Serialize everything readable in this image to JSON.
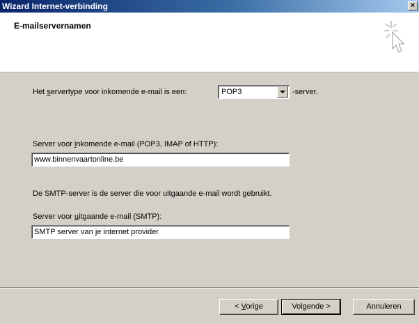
{
  "window": {
    "title": "Wizard Internet-verbinding",
    "close_glyph": "×"
  },
  "header": {
    "title": "E-mailservernamen"
  },
  "incoming_type": {
    "label_pre": "Het ",
    "label_accel": "s",
    "label_post": "ervertype voor inkomende e-mail is een:",
    "selected": "POP3",
    "suffix": "-server."
  },
  "incoming_server": {
    "label_pre": "Server voor ",
    "label_accel": "i",
    "label_post": "nkomende e-mail (POP3, IMAP of HTTP):",
    "value": "www.binnenvaartonline.be"
  },
  "smtp_info": {
    "text": "De SMTP-server is de server die voor uitgaande e-mail wordt gebruikt."
  },
  "outgoing_server": {
    "label_pre": "Server voor ",
    "label_accel": "u",
    "label_post": "itgaande e-mail (SMTP):",
    "value": "SMTP server van je internet provider"
  },
  "buttons": {
    "back_pre": "< ",
    "back_accel": "V",
    "back_post": "orige",
    "next": "Volgende >",
    "cancel": "Annuleren"
  },
  "colors": {
    "title_bar_start": "#0a246a",
    "title_bar_end": "#a6caf0",
    "dialog_face": "#d4d0c8",
    "header_bg": "#ffffff"
  },
  "icons": {
    "wizard": "wizard-cursor-sparkle-icon",
    "dropdown": "chevron-down-icon",
    "close": "close-icon"
  }
}
